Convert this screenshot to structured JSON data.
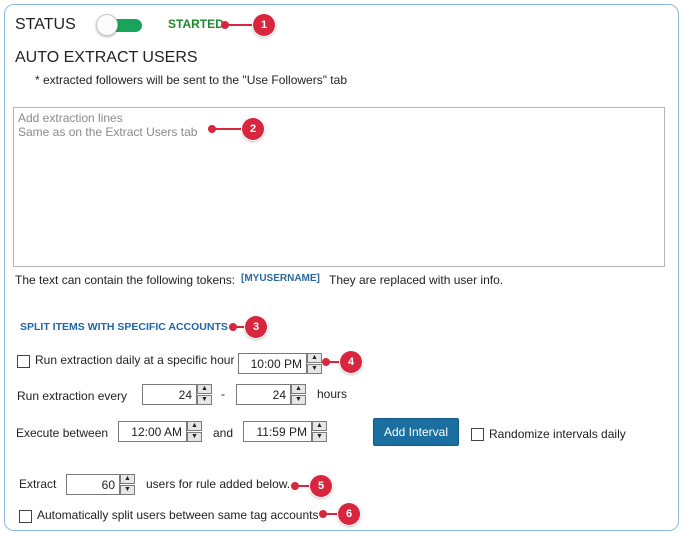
{
  "status": {
    "label": "STATUS",
    "toggle_on": true,
    "state_text": "STARTED"
  },
  "auto_extract": {
    "title": "AUTO EXTRACT USERS",
    "note": "* extracted followers will be sent to the \"Use Followers\" tab",
    "lines_value": "",
    "lines_placeholder": "Add extraction lines\nSame as on the Extract Users tab",
    "tokens_prefix": "The text can contain the following tokens:",
    "token": "[MYUSERNAME]",
    "tokens_suffix": "They are replaced with user info."
  },
  "split": {
    "heading": "SPLIT ITEMS WITH SPECIFIC ACCOUNTS",
    "daily": {
      "checked": false,
      "label": "Run extraction daily at a specific hour",
      "time": "10:00 PM"
    },
    "every": {
      "label": "Run extraction every",
      "from": "24",
      "dash": "-",
      "to": "24",
      "unit": "hours"
    },
    "between": {
      "label": "Execute between",
      "start": "12:00 AM",
      "and": "and",
      "end": "11:59 PM"
    },
    "add_interval_label": "Add Interval",
    "randomize": {
      "checked": false,
      "label": "Randomize intervals daily"
    },
    "extract": {
      "label": "Extract",
      "count": "60",
      "suffix": "users for rule added below."
    },
    "auto_split": {
      "checked": false,
      "label": "Automatically split users between same tag accounts"
    }
  },
  "callouts": [
    "1",
    "2",
    "3",
    "4",
    "5",
    "6"
  ],
  "colors": {
    "accent": "#1f66a6",
    "started": "#1d8a2b",
    "toggle": "#1aa35a",
    "callout": "#d7263d",
    "button": "#1a6fa0",
    "frame": "#8fb8dc"
  },
  "icons": {
    "spin_up": "▲",
    "spin_down": "▼"
  }
}
